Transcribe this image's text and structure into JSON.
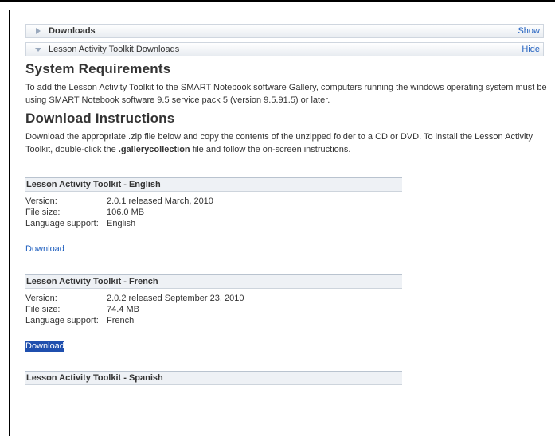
{
  "bars": [
    {
      "title": "Downloads",
      "action": "Show",
      "expanded": false
    },
    {
      "title": "Lesson Activity Toolkit Downloads",
      "action": "Hide",
      "expanded": true
    }
  ],
  "system_requirements": {
    "heading": "System Requirements",
    "text": "To add the Lesson Activity Toolkit to the SMART Notebook software Gallery, computers running the windows operating system must be using SMART Notebook software 9.5 service pack 5 (version 9.5.91.5) or later."
  },
  "download_instructions": {
    "heading": "Download Instructions",
    "text_before": "Download the appropriate .zip file below and copy the contents of the unzipped folder to a CD or DVD. To install the Lesson Activity Toolkit, double-click the ",
    "text_bold": ".gallerycollection",
    "text_after": " file and follow the on-screen instructions."
  },
  "labels": {
    "version": "Version:",
    "file_size": "File size:",
    "language_support": "Language support:"
  },
  "kits": [
    {
      "title": "Lesson Activity Toolkit - English",
      "version": "2.0.1 released March, 2010",
      "file_size": "106.0 MB",
      "language": "English",
      "download_label": "Download",
      "selected": false
    },
    {
      "title": "Lesson Activity Toolkit - French",
      "version": "2.0.2 released September 23, 2010",
      "file_size": "74.4 MB",
      "language": "French",
      "download_label": "Download",
      "selected": true
    },
    {
      "title": "Lesson Activity Toolkit - Spanish"
    }
  ],
  "colors": {
    "link": "#1f5fbf",
    "selection": "#1f4fae",
    "arrow": "#9aa9bd"
  }
}
